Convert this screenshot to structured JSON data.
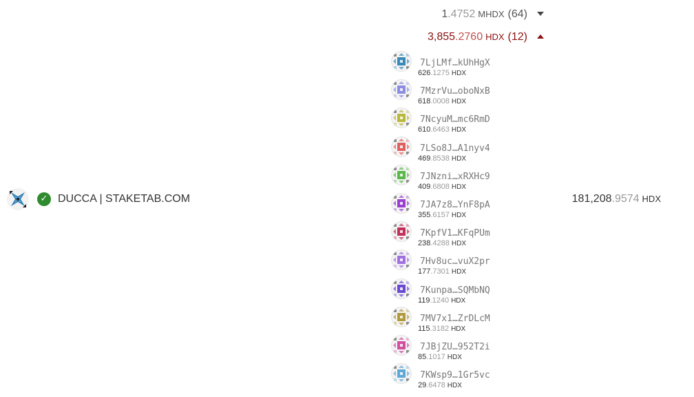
{
  "summary": {
    "mhdx": {
      "int": "1",
      "dec": ".4752",
      "unit": "MHDX",
      "count": "(64)"
    },
    "hdx": {
      "int": "3,855",
      "dec": ".2760",
      "unit": "HDX",
      "count": "(12)"
    }
  },
  "validator": {
    "name": "DUCCA | STAKETAB.COM",
    "verified_icon": "check-icon",
    "total": {
      "int": "181,208",
      "dec": ".9574",
      "unit": "HDX"
    }
  },
  "delegators": [
    {
      "address": "7LjLMf…kUhHgX",
      "amount_int": "626",
      "amount_dec": ".1275",
      "unit": "HDX",
      "color": "#3a8ab8"
    },
    {
      "address": "7MzrVu…oboNxB",
      "amount_int": "618",
      "amount_dec": ".0008",
      "unit": "HDX",
      "color": "#8c8ce0"
    },
    {
      "address": "7NcyuM…mc6RmD",
      "amount_int": "610",
      "amount_dec": ".6463",
      "unit": "HDX",
      "color": "#b8b83a"
    },
    {
      "address": "7LSo8J…A1nyv4",
      "amount_int": "469",
      "amount_dec": ".8538",
      "unit": "HDX",
      "color": "#e06060"
    },
    {
      "address": "7JNzni…xRXHc9",
      "amount_int": "409",
      "amount_dec": ".6808",
      "unit": "HDX",
      "color": "#5ab84a"
    },
    {
      "address": "7JA7z8…YnF8pA",
      "amount_int": "355",
      "amount_dec": ".6157",
      "unit": "HDX",
      "color": "#9a40d0"
    },
    {
      "address": "7KpfV1…KFqPUm",
      "amount_int": "238",
      "amount_dec": ".4288",
      "unit": "HDX",
      "color": "#c0305a"
    },
    {
      "address": "7Hv8uc…vuX2pr",
      "amount_int": "177",
      "amount_dec": ".7301",
      "unit": "HDX",
      "color": "#a070e0"
    },
    {
      "address": "7Kunpa…SQMbNQ",
      "amount_int": "119",
      "amount_dec": ".1240",
      "unit": "HDX",
      "color": "#6a4ad0"
    },
    {
      "address": "7MV7x1…ZrDLcM",
      "amount_int": "115",
      "amount_dec": ".3182",
      "unit": "HDX",
      "color": "#b09a3a"
    },
    {
      "address": "7JBjZU…952T2i",
      "amount_int": "85",
      "amount_dec": ".1017",
      "unit": "HDX",
      "color": "#d050a0"
    },
    {
      "address": "7KWsp9…1Gr5vc",
      "amount_int": "29",
      "amount_dec": ".6478",
      "unit": "HDX",
      "color": "#60a8d8"
    }
  ]
}
